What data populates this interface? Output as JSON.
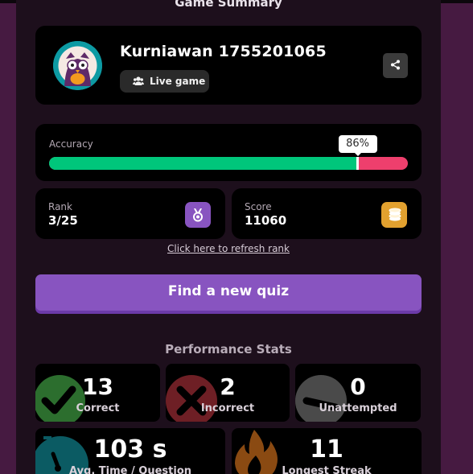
{
  "summary": {
    "title": "Game Summary"
  },
  "player": {
    "name": "Kurniawan 1755201065",
    "live_label": "Live game",
    "avatar_icon": "owl-avatar",
    "live_icon": "users-icon",
    "share_icon": "share-icon"
  },
  "accuracy": {
    "label": "Accuracy",
    "value": 86,
    "value_text": "86%",
    "correct_color": "#00c67b",
    "incorrect_color": "#ee3f6d"
  },
  "rank": {
    "label": "Rank",
    "value": "3/25",
    "icon": "medal-icon",
    "icon_color": "#8854c0"
  },
  "score": {
    "label": "Score",
    "value": "11060",
    "icon": "coins-icon",
    "icon_color": "#e2a12f"
  },
  "refresh_link": "Click here to refresh rank",
  "find_quiz_button": "Find a new quiz",
  "performance": {
    "title": "Performance Stats",
    "stats": [
      {
        "value": "13",
        "label": "Correct",
        "icon": "check-icon",
        "color": "#2c6e2e"
      },
      {
        "value": "2",
        "label": "Incorrect",
        "icon": "cross-icon",
        "color": "#6e1f25"
      },
      {
        "value": "0",
        "label": "Unattempted",
        "icon": "minus-icon",
        "color": "#4a4a4a"
      }
    ],
    "stats2": [
      {
        "value": "103 s",
        "label": "Avg. Time / Question",
        "icon": "stopwatch-icon",
        "color": "#0b5b63"
      },
      {
        "value": "11",
        "label": "Longest Streak",
        "icon": "flame-icon",
        "color": "#8a4a12"
      }
    ]
  }
}
